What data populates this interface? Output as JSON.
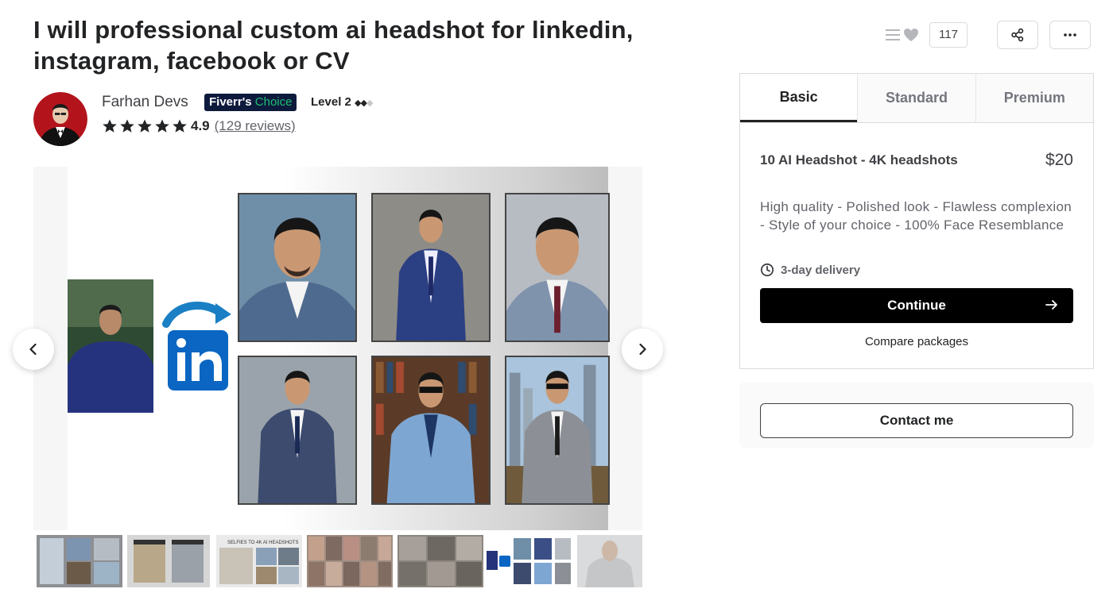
{
  "gig": {
    "title": "I will professional custom ai headshot for linkedin, instagram, facebook or CV"
  },
  "seller": {
    "name": "Farhan Devs",
    "badge_part1": "Fiverr's",
    "badge_part2": "Choice",
    "level": "Level 2",
    "rating": "4.9",
    "reviews": "(129 reviews)",
    "stars": 5
  },
  "actions": {
    "save_count": "117",
    "icons": [
      "list-icon",
      "heart-icon",
      "share-icon",
      "more-icon"
    ]
  },
  "gallery": {
    "prev_icon": "chevron-left-icon",
    "next_icon": "chevron-right-icon",
    "thumbnail_count": 7,
    "thumb_text_3": "SELFIES TO 4K AI HEADSHOTS"
  },
  "package": {
    "tabs": [
      "Basic",
      "Standard",
      "Premium"
    ],
    "active_tab": "Basic",
    "title": "10 AI Headshot - 4K headshots",
    "price": "$20",
    "description": "High quality - Polished look - Flawless complexion - Style of your choice - 100% Face Resemblance",
    "delivery": "3-day delivery",
    "continue_label": "Continue",
    "compare_label": "Compare packages"
  },
  "contact": {
    "label": "Contact me"
  },
  "colors": {
    "brand_green": "#1dbf73",
    "badge_navy": "#0e1a3c",
    "linkedin_blue": "#0a66c2",
    "button_black": "#000000"
  }
}
